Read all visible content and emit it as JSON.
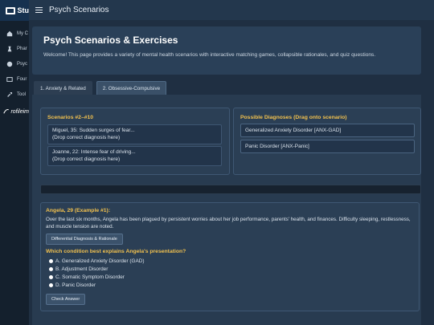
{
  "sidebar": {
    "brand": "Stu",
    "items": [
      {
        "label": "My C",
        "icon": "home-icon"
      },
      {
        "label": "Phar",
        "icon": "flask-icon"
      },
      {
        "label": "Psyc",
        "icon": "brain-icon"
      },
      {
        "label": "Four",
        "icon": "folder-icon"
      },
      {
        "label": "Tool",
        "icon": "wrench-icon"
      }
    ],
    "logo_text": "rofileim"
  },
  "topbar": {
    "title": "Psych Scenarios"
  },
  "header": {
    "title": "Psych Scenarios & Exercises",
    "description": "Welcome! This page provides a variety of mental health scenarios with interactive matching games, collapsible rationales, and quiz questions."
  },
  "tabs": [
    {
      "label": "1. Anxiety & Related",
      "active": false
    },
    {
      "label": "2. Obsessive-Compulsive",
      "active": true
    }
  ],
  "scenarios": {
    "title": "Scenarios #2–#10",
    "items": [
      {
        "line1": "Miguel, 35: Sudden surges of fear...",
        "line2": "(Drop correct diagnosis here)"
      },
      {
        "line1": "Joanne, 22: Intense fear of driving...",
        "line2": "(Drop correct diagnosis here)"
      }
    ]
  },
  "diagnoses": {
    "title": "Possible Diagnoses (Drag onto scenario)",
    "items": [
      "Generalized Anxiety Disorder [ANX-GAD]",
      "Panic Disorder [ANX-Panic]"
    ]
  },
  "example": {
    "title": "Angela, 29 (Example #1):",
    "text": "Over the last six months, Angela has been plagued by persistent worries about her job performance, parents' health, and finances. Difficulty sleeping, restlessness, and muscle tension are noted.",
    "rationale_button": "Differential Diagnosis & Rationale",
    "question": "Which condition best explains Angela's presentation?",
    "options": [
      "A. Generalized Anxiety Disorder (GAD)",
      "B. Adjustment Disorder",
      "C. Somatic Symptom Disorder",
      "D. Panic Disorder"
    ],
    "check_button": "Check Answer"
  }
}
